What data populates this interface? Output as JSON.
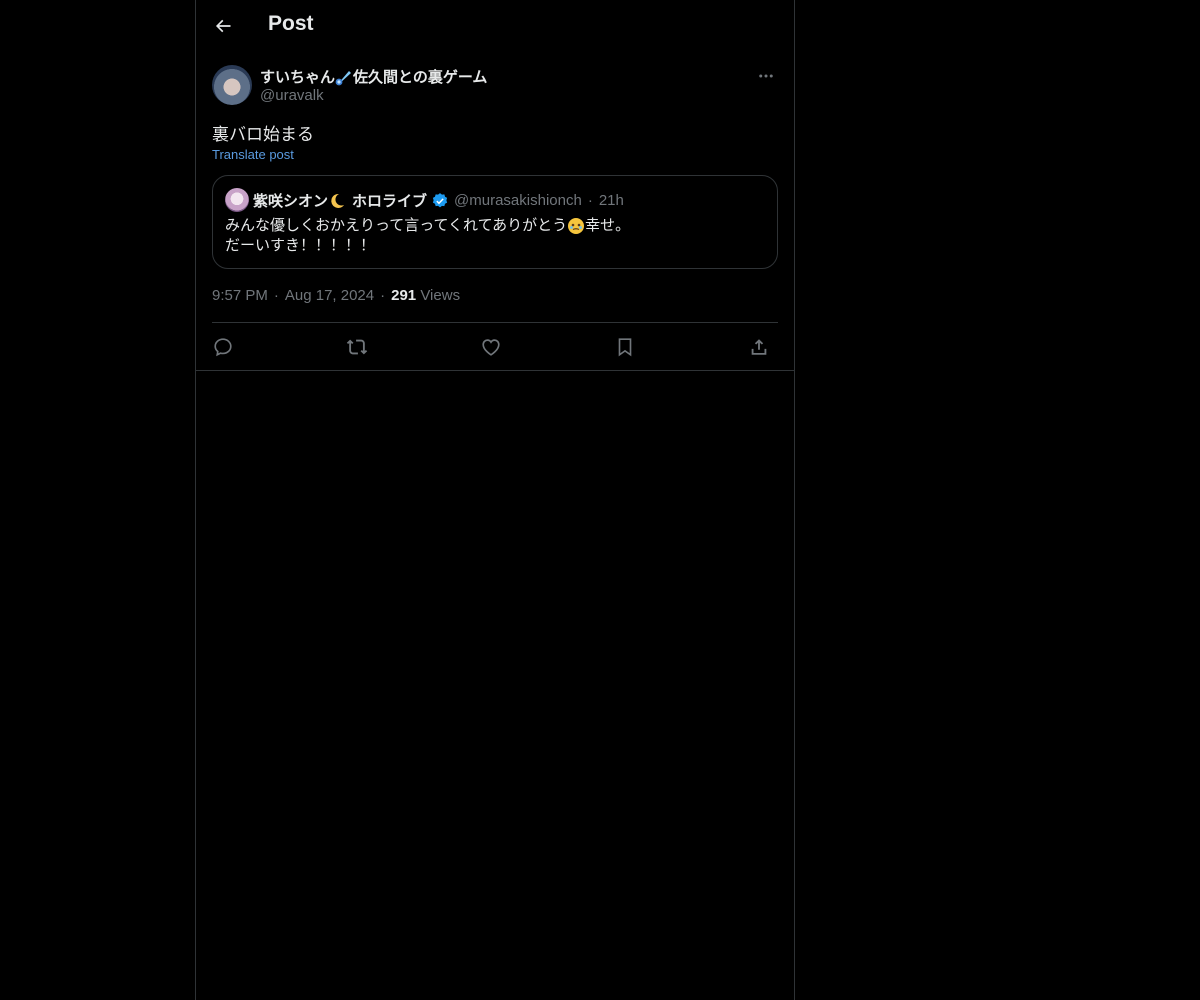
{
  "header": {
    "back_icon": "arrow-left-icon",
    "title": "Post"
  },
  "post": {
    "author": {
      "name_prefix": "すいちゃん",
      "name_emoji": "comet-emoji",
      "name_suffix": "佐久間との裏ゲーム",
      "handle": "@uravalk"
    },
    "text": "裏バロ始まる",
    "translate_label": "Translate post",
    "quoted": {
      "name_prefix": "紫咲シオン",
      "name_emoji": "crescent-moon-emoji",
      "name_suffix": "ホロライブ",
      "verified": true,
      "handle": "@murasakishionch",
      "time": "21h",
      "line1_before_emoji": "みんな優しくおかえりって言ってくれてありがとう",
      "line1_emoji": "face-holding-back-tears-emoji",
      "line1_after_emoji": "幸せ。",
      "line2": "だーいすき！！！！！"
    },
    "meta": {
      "time": "9:57 PM",
      "date": "Aug 17, 2024",
      "views_count": "291",
      "views_label": "Views"
    },
    "actions": [
      "reply-icon",
      "repost-icon",
      "like-icon",
      "bookmark-icon",
      "share-icon"
    ]
  },
  "colors": {
    "background": "#000000",
    "text_primary": "#e7e9ea",
    "text_secondary": "#71767b",
    "link": "#5a9be0",
    "verified": "#1d9bf0",
    "border": "#2f3336"
  }
}
